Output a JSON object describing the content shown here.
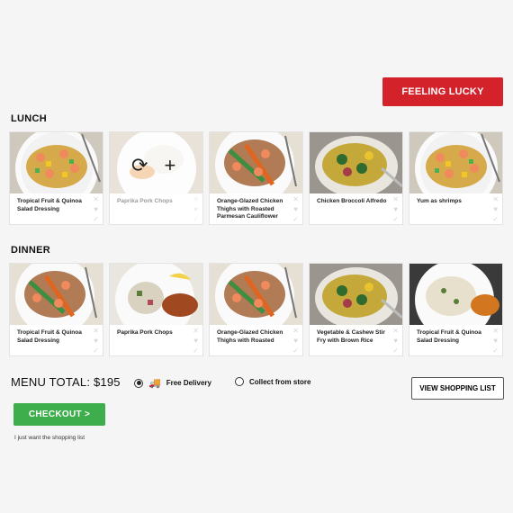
{
  "header": {
    "lucky_label": "FEELING LUCKY"
  },
  "lunch": {
    "title": "LUNCH",
    "meals": [
      {
        "name": "Tropical Fruit & Quinoa Salad Dressing",
        "photo": "shrimp-quinoa"
      },
      {
        "name": "Paprika Pork Chops",
        "photo": "rice-plate",
        "hovered": true
      },
      {
        "name": "Orange-Glazed Chicken Thighs with Roasted Parmesan Cauliflower",
        "photo": "noodle-shrimp"
      },
      {
        "name": "Chicken Broccoli Alfredo",
        "photo": "veg-bowl"
      },
      {
        "name": "Yum as shrimps",
        "photo": "shrimp-quinoa"
      }
    ]
  },
  "dinner": {
    "title": "DINNER",
    "meals": [
      {
        "name": "Tropical Fruit & Quinoa Salad Dressing",
        "photo": "noodle-shrimp"
      },
      {
        "name": "Paprika Pork Chops",
        "photo": "pork-salad"
      },
      {
        "name": "Orange-Glazed Chicken Thighs with Roasted",
        "photo": "noodle-shrimp"
      },
      {
        "name": "Vegetable & Cashew Stir Fry with Brown Rice",
        "photo": "veg-bowl"
      },
      {
        "name": "Tropical Fruit & Quinoa Salad Dressing",
        "photo": "pasta-plate"
      }
    ]
  },
  "footer": {
    "total": "MENU TOTAL: $195",
    "delivery_label": "Free Delivery",
    "collect_label": "Collect from store",
    "delivery_selected": true,
    "shopping_list_label": "VIEW SHOPPING LIST",
    "checkout_label": "CHECKOUT  >",
    "shopping_only_link": "I just want the shopping list"
  },
  "colors": {
    "accent_red": "#d3222a",
    "checkout_green": "#3dae4b"
  },
  "icons": {
    "remove": "close-icon",
    "favorite": "heart-icon",
    "accept": "check-icon",
    "swap": "refresh-icon",
    "add": "plus-icon",
    "truck": "truck-icon"
  }
}
